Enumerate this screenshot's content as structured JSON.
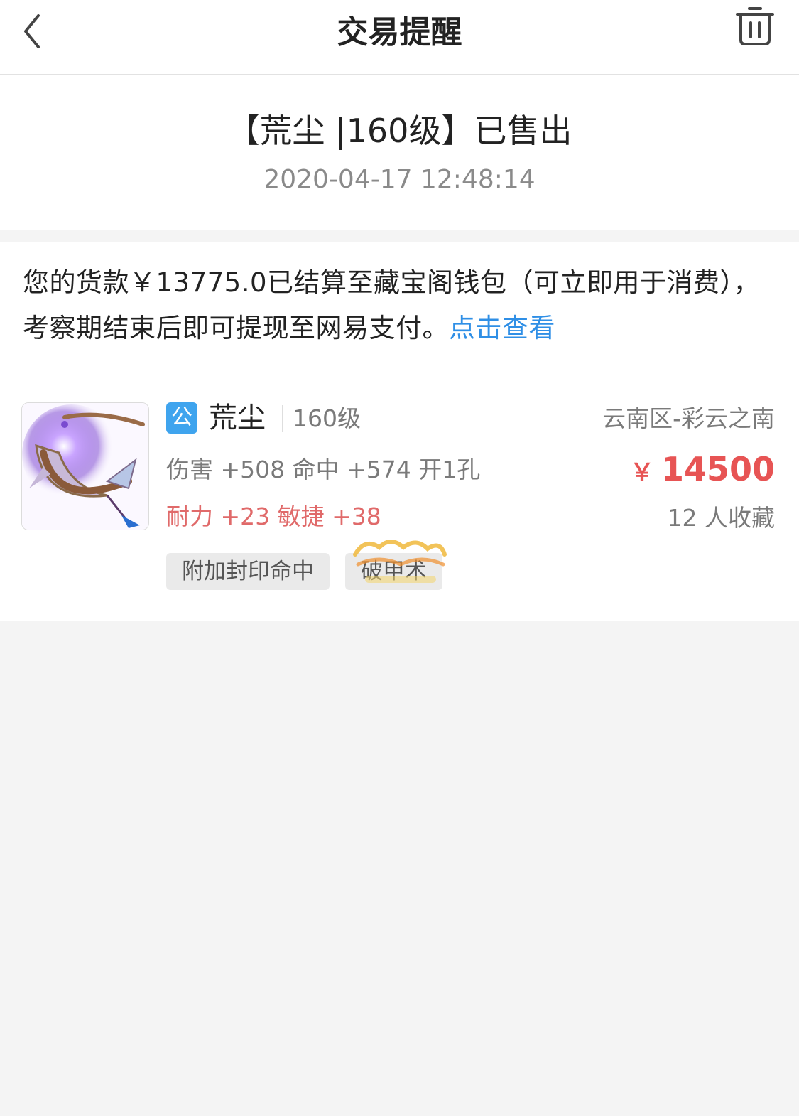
{
  "nav": {
    "title": "交易提醒",
    "back_icon": "chevron-left-icon",
    "trash_icon": "trash-icon"
  },
  "header": {
    "title": "【荒尘 |160级】已售出",
    "datetime": "2020-04-17 12:48:14"
  },
  "message": {
    "text": "您的货款￥13775.0已结算至藏宝阁钱包（可立即用于消费），考察期结束后即可提现至网易支付。",
    "link_text": "点击查看"
  },
  "item": {
    "badge": "公",
    "name": "荒尘",
    "level": "160级",
    "server": "云南区-彩云之南",
    "stats_line1": "伤害 +508 命中 +574 开1孔",
    "stats_line2": "耐力 +23 敏捷 +38",
    "currency_symbol": "￥",
    "price": "14500",
    "favorites": "12 人收藏",
    "tags": [
      "附加封印命中",
      "破甲术"
    ]
  },
  "colors": {
    "link": "#2f8fe6",
    "price": "#e75454",
    "badge": "#3fa4ee",
    "bonus_stats": "#e06a6a"
  }
}
